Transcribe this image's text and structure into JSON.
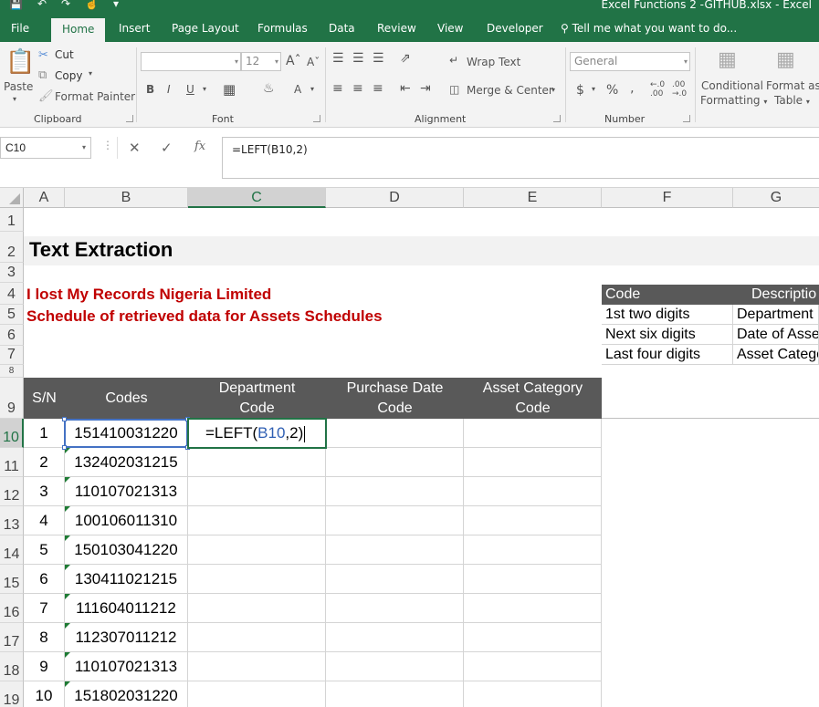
{
  "window": {
    "title": "Excel Functions 2 -GITHUB.xlsx - Excel"
  },
  "ribbon_tabs": [
    "File",
    "Home",
    "Insert",
    "Page Layout",
    "Formulas",
    "Data",
    "Review",
    "View",
    "Developer"
  ],
  "active_tab": "Home",
  "tell_me": "Tell me what you want to do...",
  "clipboard": {
    "paste": "Paste",
    "cut": "Cut",
    "copy": "Copy",
    "format_painter": "Format Painter",
    "label": "Clipboard"
  },
  "font": {
    "name": "",
    "size": "12",
    "label": "Font",
    "bold": "B",
    "italic": "I",
    "underline": "U"
  },
  "alignment": {
    "wrap_text": "Wrap Text",
    "merge_center": "Merge & Center",
    "label": "Alignment"
  },
  "number": {
    "format": "General",
    "label": "Number"
  },
  "styles": {
    "conditional": "Conditional",
    "formatting": "Formatting",
    "format_as": "Format as",
    "table": "Table"
  },
  "formula_bar": {
    "name_box": "C10",
    "formula": "=LEFT(B10,2)",
    "cancel": "✕",
    "enter": "✓",
    "fx": "fx"
  },
  "columns": [
    "A",
    "B",
    "C",
    "D",
    "E",
    "F",
    "G"
  ],
  "selected_column": "C",
  "rows": [
    "1",
    "2",
    "3",
    "4",
    "5",
    "6",
    "7",
    "8",
    "9",
    "10",
    "11",
    "12",
    "13",
    "14",
    "15",
    "16",
    "17",
    "18",
    "19"
  ],
  "selected_row": "10",
  "sheet": {
    "title": "Text Extraction",
    "company": "I lost My Records Nigeria Limited",
    "subtitle": "Schedule of retrieved data for Assets Schedules",
    "headers": {
      "sn": "S/N",
      "codes": "Codes",
      "dept": "Department Code",
      "purchase": "Purchase Date Code",
      "asset": "Asset Category Code"
    },
    "data_rows": [
      {
        "sn": "1",
        "code": "151410031220"
      },
      {
        "sn": "2",
        "code": "132402031215"
      },
      {
        "sn": "3",
        "code": "110107021313"
      },
      {
        "sn": "4",
        "code": "100106011310"
      },
      {
        "sn": "5",
        "code": "150103041220"
      },
      {
        "sn": "6",
        "code": "130411021215"
      },
      {
        "sn": "7",
        "code": "111604011212"
      },
      {
        "sn": "8",
        "code": "112307011212"
      },
      {
        "sn": "9",
        "code": "110107021313"
      },
      {
        "sn": "10",
        "code": "151802031220"
      }
    ],
    "editing_cell": {
      "prefix": "=LEFT(",
      "ref": "B10",
      "suffix": ",2)"
    },
    "reference_table": {
      "header_code": "Code",
      "header_desc": "Descriptio",
      "rows": [
        {
          "code": "1st two digits",
          "desc": "Department"
        },
        {
          "code": "Next six digits",
          "desc": "Date of Asse"
        },
        {
          "code": "Last four digits",
          "desc": "Asset Catego"
        }
      ]
    }
  }
}
